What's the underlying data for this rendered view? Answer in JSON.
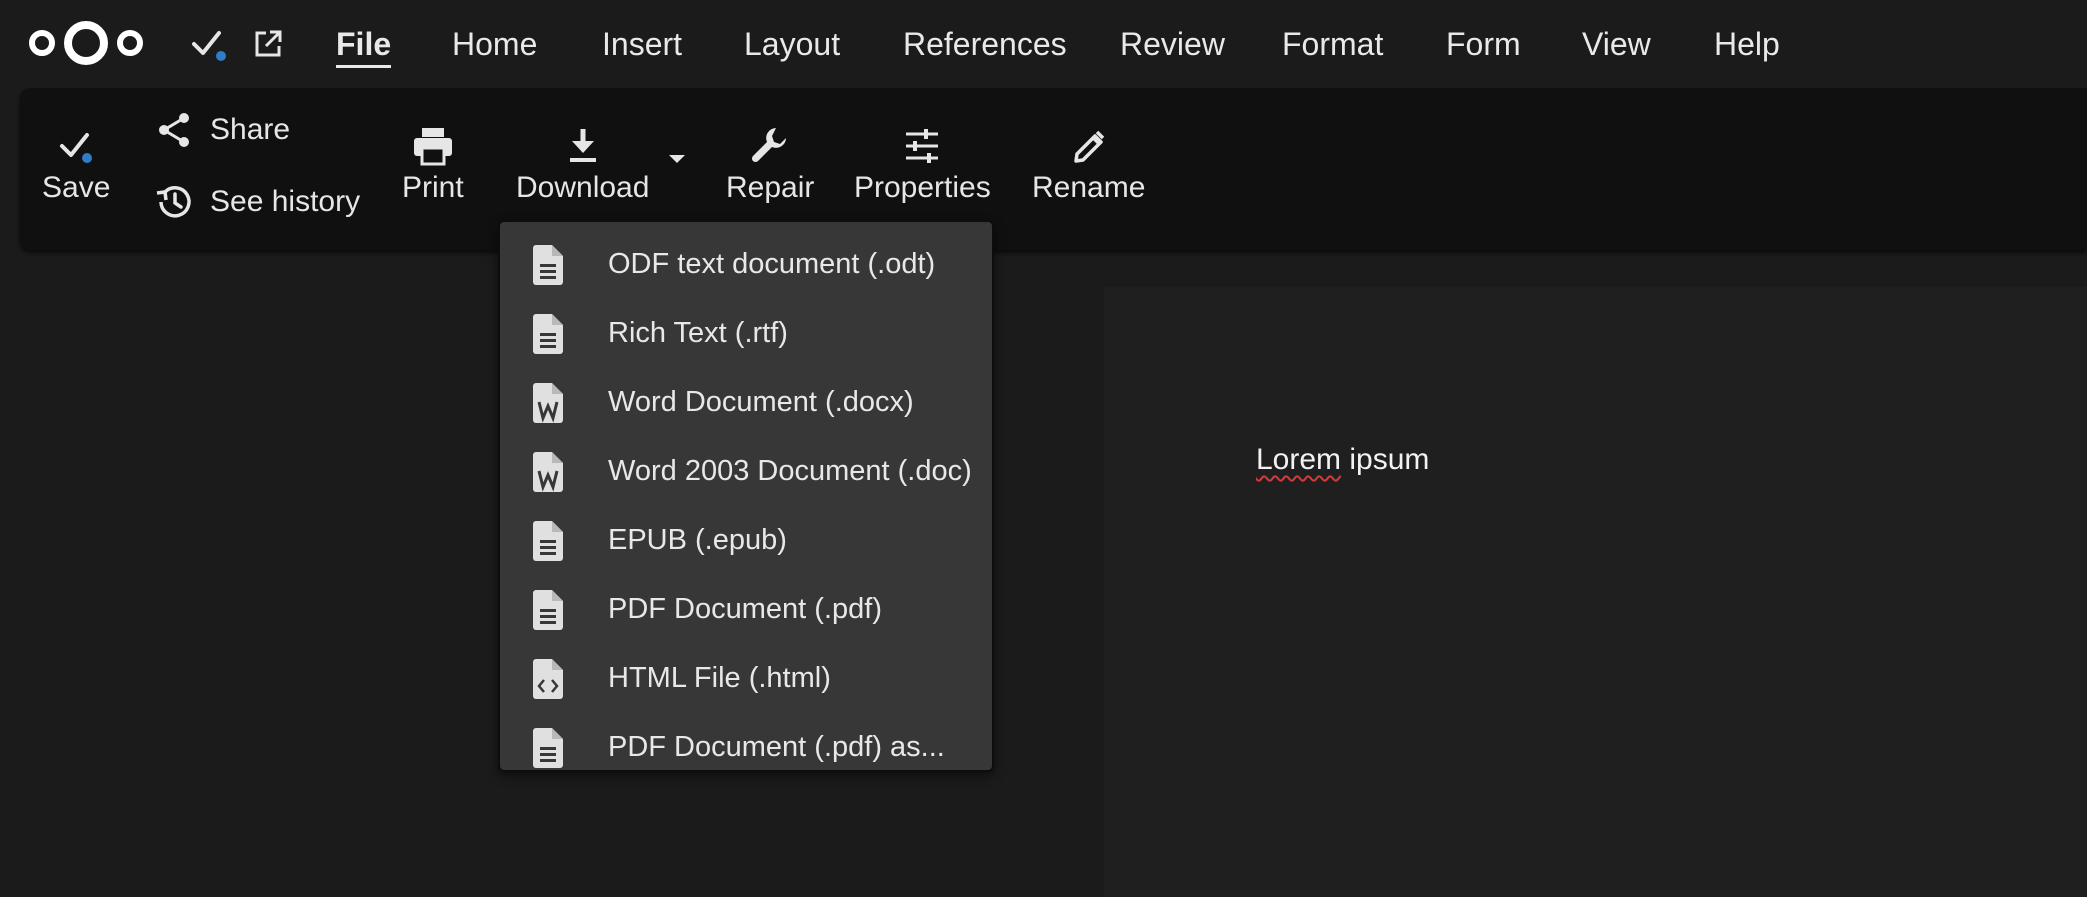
{
  "menubar": {
    "items": [
      {
        "label": "File",
        "active": true
      },
      {
        "label": "Home"
      },
      {
        "label": "Insert"
      },
      {
        "label": "Layout"
      },
      {
        "label": "References"
      },
      {
        "label": "Review"
      },
      {
        "label": "Format"
      },
      {
        "label": "Form"
      },
      {
        "label": "View"
      },
      {
        "label": "Help"
      }
    ]
  },
  "ribbon": {
    "save": "Save",
    "share": "Share",
    "see_history": "See history",
    "print": "Print",
    "download": "Download",
    "repair": "Repair",
    "properties": "Properties",
    "rename": "Rename"
  },
  "download_menu": {
    "items": [
      {
        "label": "ODF text document (.odt)",
        "icon": "document-icon"
      },
      {
        "label": "Rich Text (.rtf)",
        "icon": "document-icon"
      },
      {
        "label": "Word Document (.docx)",
        "icon": "word-document-icon"
      },
      {
        "label": "Word 2003 Document (.doc)",
        "icon": "word-document-icon"
      },
      {
        "label": "EPUB (.epub)",
        "icon": "document-icon"
      },
      {
        "label": "PDF Document (.pdf)",
        "icon": "document-icon"
      },
      {
        "label": "HTML File (.html)",
        "icon": "code-file-icon"
      },
      {
        "label": "PDF Document (.pdf) as...",
        "icon": "document-icon"
      }
    ]
  },
  "document": {
    "word1": "Lorem",
    "word2": " ipsum"
  },
  "colors": {
    "background": "#1b1b1b",
    "ribbon": "#101010",
    "dropdown": "#373737",
    "accent_dot": "#2f7dc8",
    "spell_error": "#d23b3b"
  }
}
